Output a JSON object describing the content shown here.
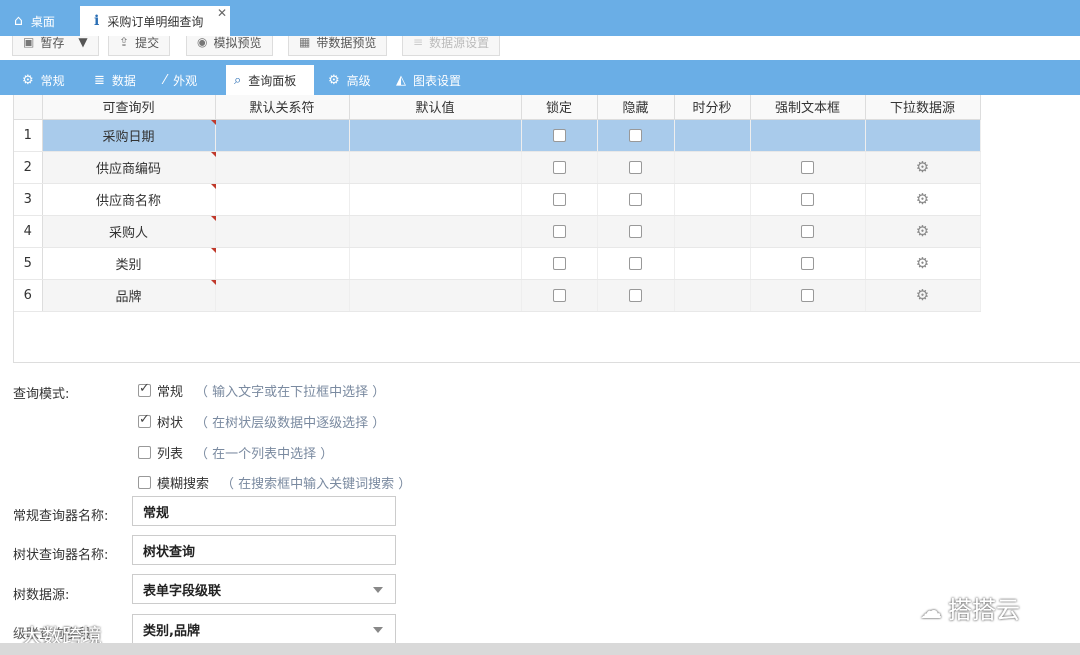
{
  "top_tabs": [
    {
      "label": "桌面",
      "icon": "home-icon"
    },
    {
      "label": "采购订单明细查询",
      "icon": "info-icon"
    }
  ],
  "toolbar": {
    "buttons": [
      {
        "label": "暂存",
        "icon": "save-icon"
      },
      {
        "label": "提交",
        "icon": "upload-icon"
      },
      {
        "label": "模拟预览",
        "icon": "eye-icon"
      },
      {
        "label": "带数据预览",
        "icon": "grid-icon"
      },
      {
        "label": "数据源设置",
        "icon": "database-icon"
      }
    ]
  },
  "sub_tabs": [
    {
      "label": "常规",
      "icon": "gear-icon"
    },
    {
      "label": "数据",
      "icon": "database-icon"
    },
    {
      "label": "外观",
      "icon": "magic-wand-icon"
    },
    {
      "label": "查询面板",
      "icon": "search-icon"
    },
    {
      "label": "高级",
      "icon": "gears-icon"
    },
    {
      "label": "图表设置",
      "icon": "area-chart-icon"
    }
  ],
  "grid": {
    "columns": [
      "可查询列",
      "默认关系符",
      "默认值",
      "锁定",
      "隐藏",
      "时分秒",
      "强制文本框",
      "下拉数据源"
    ],
    "rows": [
      {
        "num": "1",
        "name": "采购日期",
        "locked": false,
        "hidden": false,
        "force_text": null,
        "dropdown": false
      },
      {
        "num": "2",
        "name": "供应商编码",
        "locked": false,
        "hidden": false,
        "force_text": false,
        "dropdown": true
      },
      {
        "num": "3",
        "name": "供应商名称",
        "locked": false,
        "hidden": false,
        "force_text": false,
        "dropdown": true
      },
      {
        "num": "4",
        "name": "采购人",
        "locked": false,
        "hidden": false,
        "force_text": false,
        "dropdown": true
      },
      {
        "num": "5",
        "name": "类别",
        "locked": false,
        "hidden": false,
        "force_text": false,
        "dropdown": true
      },
      {
        "num": "6",
        "name": "品牌",
        "locked": false,
        "hidden": false,
        "force_text": false,
        "dropdown": true
      }
    ]
  },
  "form": {
    "query_mode_label": "查询模式:",
    "modes": [
      {
        "label": "常规",
        "hint": "（ 输入文字或在下拉框中选择 ）",
        "checked": true
      },
      {
        "label": "树状",
        "hint": "（ 在树状层级数据中逐级选择 ）",
        "checked": true
      },
      {
        "label": "列表",
        "hint": "（ 在一个列表中选择 ）",
        "checked": false
      },
      {
        "label": "模糊搜索",
        "hint": "（ 在搜索框中输入关键词搜索 ）",
        "checked": false
      }
    ],
    "normal_name_label": "常规查询器名称:",
    "normal_name_value": "常规",
    "tree_name_label": "树状查询器名称:",
    "tree_name_value": "树状查询",
    "tree_source_label": "树数据源:",
    "tree_source_value": "表单字段级联",
    "cascade_label": "级联查询字段:",
    "cascade_value": "类别,品牌"
  },
  "watermarks": {
    "right": "搭搭云",
    "left": "大数跨境"
  }
}
